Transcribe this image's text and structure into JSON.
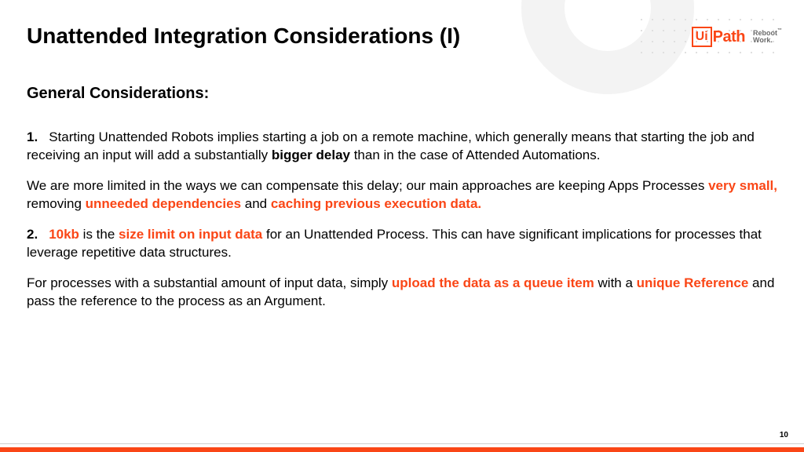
{
  "brand": {
    "ui": "Ui",
    "path": "Path",
    "tagline": "Reboot\nWork."
  },
  "title": "Unattended Integration Considerations (I)",
  "subtitle": "General Considerations:",
  "p1": {
    "num": "1.",
    "a": "Starting Unattended Robots implies starting a job on a remote machine, which generally means that starting the job and receiving an input will add a substantially ",
    "b": "bigger delay",
    "c": " than in the case of Attended Automations."
  },
  "p2": {
    "a": "We are more limited in the ways we can compensate this delay; our main approaches are keeping Apps Processes ",
    "h1": "very small,",
    "b": " removing ",
    "h2": "unneeded dependencies",
    "c": " and ",
    "h3": "caching previous execution data."
  },
  "p3": {
    "num": "2.",
    "h1": "10kb",
    "a": " is the ",
    "h2": "size limit on input data",
    "b": " for an Unattended Process. This can have significant implications for processes that leverage repetitive data structures."
  },
  "p4": {
    "a": "For processes with a substantial amount of input data, simply ",
    "h1": "upload the data as a queue item",
    "b": " with a ",
    "h2": "unique Reference",
    "c": " and pass the reference to the process as an Argument."
  },
  "pageNumber": "10"
}
